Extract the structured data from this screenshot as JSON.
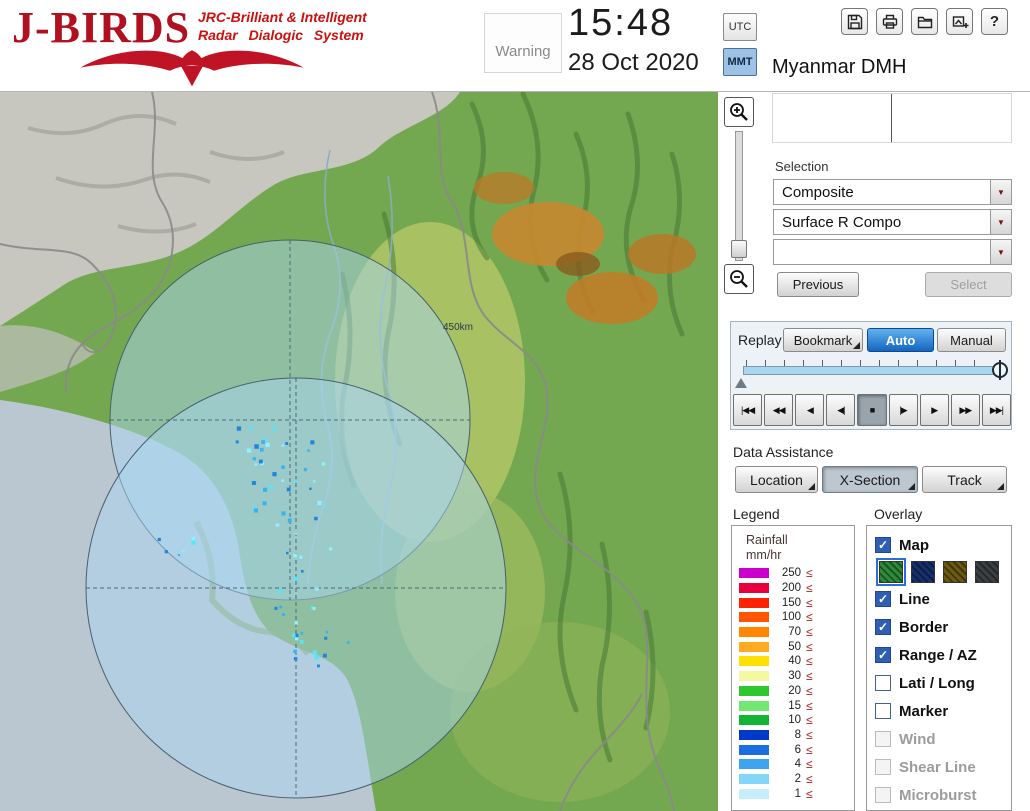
{
  "header": {
    "logo": {
      "title": "J-BIRDS",
      "subtitle_line1": "JRC-Brilliant & Intelligent",
      "subtitle_line2": "Radar Dialogic System"
    },
    "warning_label": "Warning",
    "clock": {
      "time": "15:48",
      "date": "28 Oct 2020"
    },
    "timezone": {
      "utc": "UTC",
      "mmt": "MMT",
      "selected": "MMT"
    },
    "station": "Myanmar DMH",
    "toolbar_icons": [
      "save-icon",
      "print-icon",
      "open-folder-icon",
      "screenshot-icon",
      "help-icon"
    ]
  },
  "map": {
    "range_label": "450km",
    "colors": {
      "land_green": "#74a850",
      "sea": "#bac7d0",
      "radar_fill": "#a9d5ef"
    },
    "rain_colors": [
      "#5ae4f8",
      "#34b4f2",
      "#1f86e0",
      "#90f0ff"
    ]
  },
  "selection": {
    "label": "Selection",
    "dropdowns": [
      {
        "value": "Composite"
      },
      {
        "value": "Surface R Compo"
      },
      {
        "value": ""
      }
    ],
    "previous_label": "Previous",
    "select_label": "Select"
  },
  "replay": {
    "label": "Replay",
    "bookmark_label": "Bookmark",
    "auto_label": "Auto",
    "manual_label": "Manual",
    "playback": [
      "|◀◀",
      "◀◀",
      "◀",
      "◀|",
      "■",
      "|▶",
      "▶",
      "▶▶",
      "▶▶|"
    ]
  },
  "data_assistance": {
    "label": "Data Assistance",
    "buttons": [
      "Location",
      "X-Section",
      "Track"
    ]
  },
  "legend": {
    "label": "Legend",
    "title_line1": "Rainfall",
    "title_line2": "mm/hr",
    "lte_symbol": "≤",
    "entries": [
      {
        "value": "250",
        "color": "#cc00cc"
      },
      {
        "value": "200",
        "color": "#e8003c"
      },
      {
        "value": "150",
        "color": "#ff2200"
      },
      {
        "value": "100",
        "color": "#ff5500"
      },
      {
        "value": "70",
        "color": "#ff8800"
      },
      {
        "value": "50",
        "color": "#ffaa22"
      },
      {
        "value": "40",
        "color": "#ffe000"
      },
      {
        "value": "30",
        "color": "#f4f8a0"
      },
      {
        "value": "20",
        "color": "#2ec82e"
      },
      {
        "value": "15",
        "color": "#71e871"
      },
      {
        "value": "10",
        "color": "#12b434"
      },
      {
        "value": "8",
        "color": "#0038cc"
      },
      {
        "value": "6",
        "color": "#1a6ee0"
      },
      {
        "value": "4",
        "color": "#3fa4f0"
      },
      {
        "value": "2",
        "color": "#84d6f8"
      },
      {
        "value": "1",
        "color": "#c6eefc"
      }
    ]
  },
  "overlay": {
    "label": "Overlay",
    "items": [
      {
        "label": "Map",
        "checked": true,
        "enabled": true
      },
      {
        "label": "Line",
        "checked": true,
        "enabled": true
      },
      {
        "label": "Border",
        "checked": true,
        "enabled": true
      },
      {
        "label": "Range / AZ",
        "checked": true,
        "enabled": true
      },
      {
        "label": "Lati / Long",
        "checked": false,
        "enabled": true
      },
      {
        "label": "Marker",
        "checked": false,
        "enabled": true
      },
      {
        "label": "Wind",
        "checked": false,
        "enabled": false
      },
      {
        "label": "Shear Line",
        "checked": false,
        "enabled": false
      },
      {
        "label": "Microburst",
        "checked": false,
        "enabled": false
      }
    ],
    "map_swatches": [
      {
        "color": "#2e8b3a",
        "selected": true
      },
      {
        "color": "#16306e",
        "selected": false
      },
      {
        "color": "#6b5a10",
        "selected": false
      },
      {
        "color": "#3c4044",
        "selected": false
      }
    ]
  }
}
